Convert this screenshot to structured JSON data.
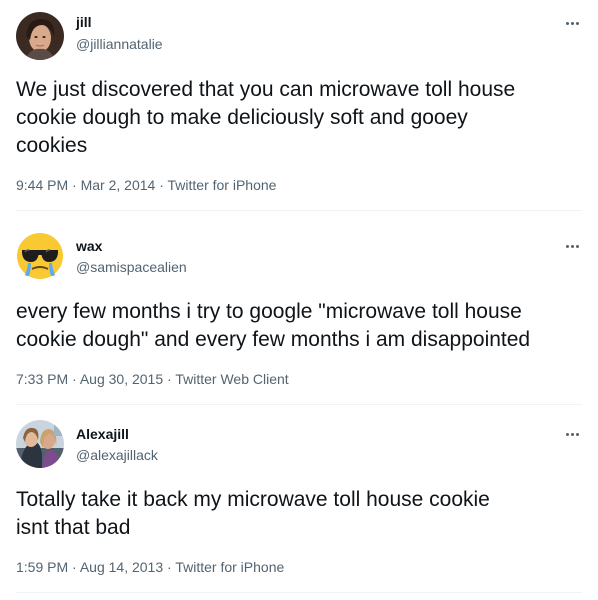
{
  "tweets": [
    {
      "name": "jill",
      "handle": "@jilliannatalie",
      "text": "We just discovered that you can microwave toll house\ncookie dough to make deliciously soft and gooey\ncookies",
      "time": "9:44 PM",
      "date": "Mar 2, 2014",
      "source": "Twitter for iPhone",
      "avatar_icon": "woman-portrait-avatar"
    },
    {
      "name": "wax",
      "handle": "@samispacealien",
      "text": "every few months i try to google \"microwave toll house\ncookie dough\" and every few months i am disappointed",
      "time": "7:33 PM",
      "date": "Aug 30, 2015",
      "source": "Twitter Web Client",
      "avatar_icon": "crying-sunglasses-emoji-avatar"
    },
    {
      "name": "Alexajill",
      "handle": "@alexajillack",
      "text": "Totally take it back my microwave toll house cookie\nisnt that bad",
      "time": "1:59 PM",
      "date": "Aug 14, 2013",
      "source": "Twitter for iPhone",
      "avatar_icon": "group-photo-avatar"
    }
  ],
  "separator": "·",
  "colors": {
    "text_primary": "#0f1419",
    "text_secondary": "#536471",
    "divider": "#eff3f4",
    "emoji_yellow": "#f9c934",
    "tear_blue": "#5dadec"
  }
}
